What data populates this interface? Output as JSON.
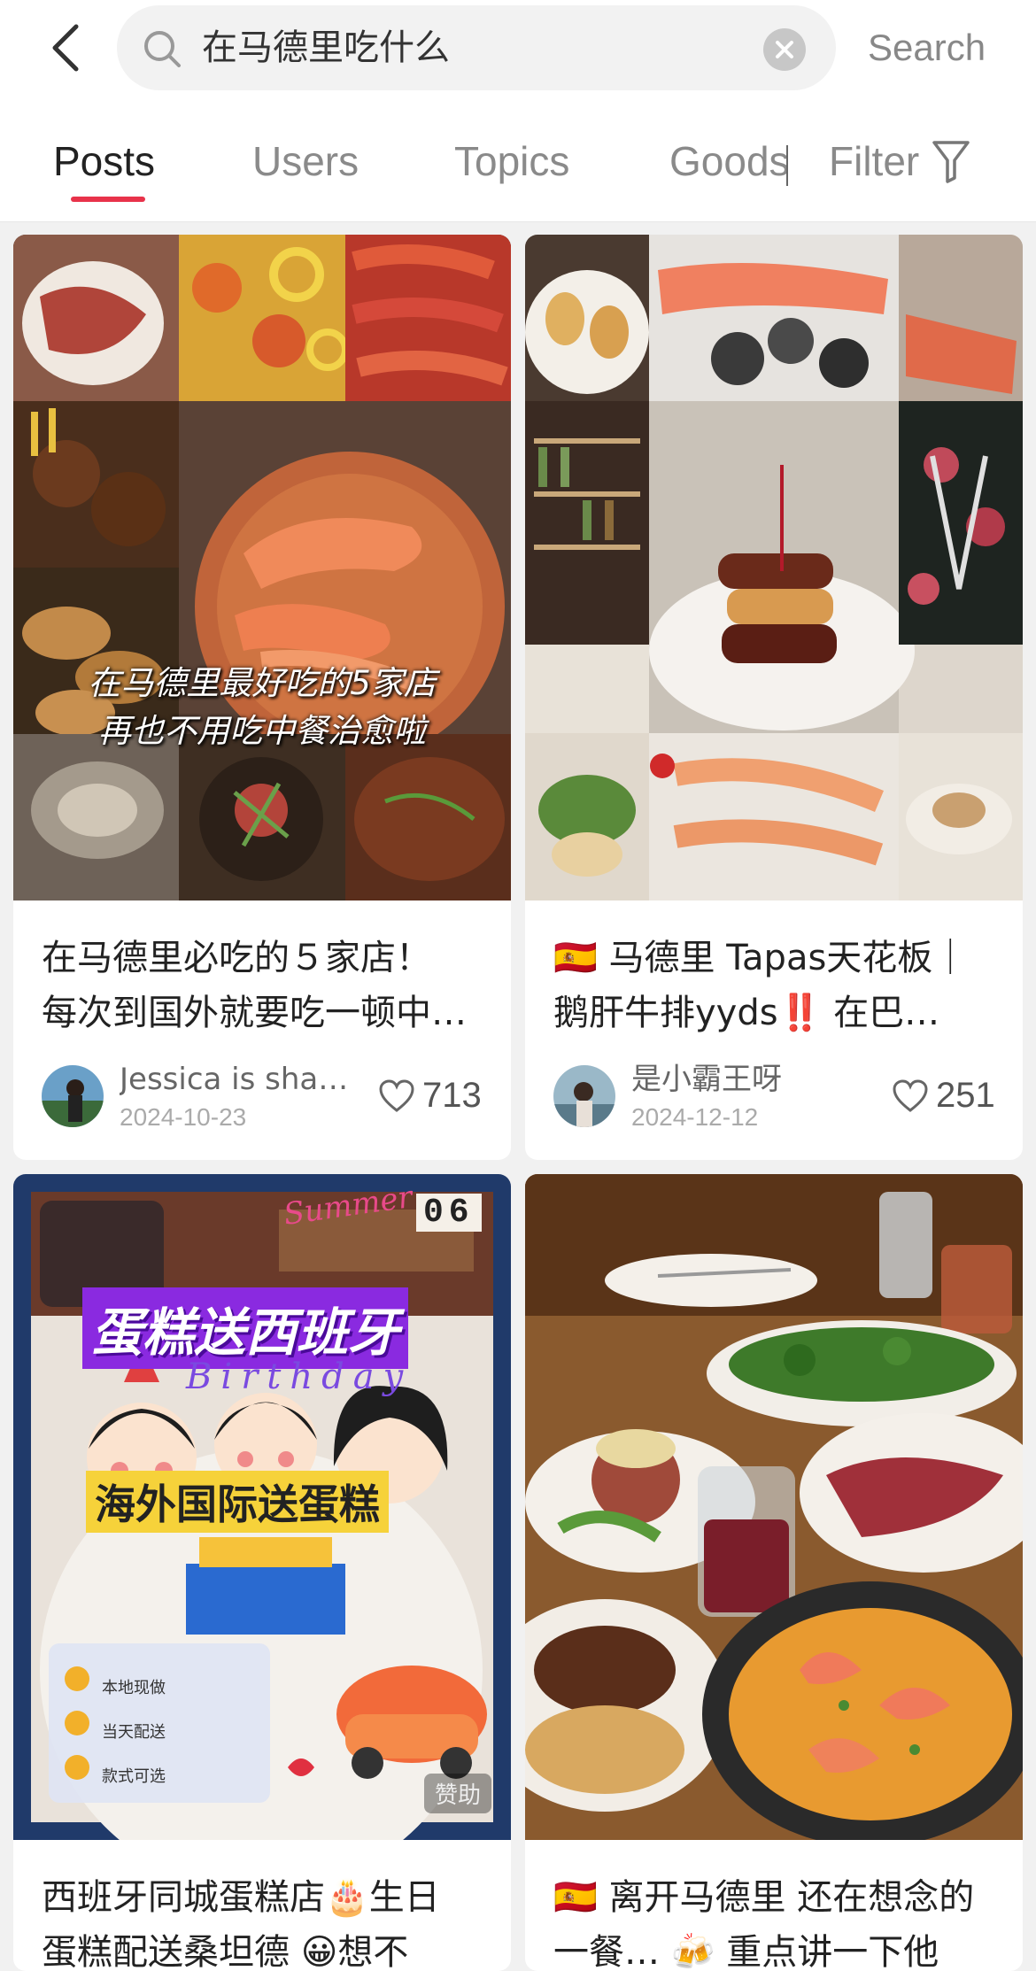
{
  "search": {
    "query": "在马德里吃什么",
    "action_label": "Search"
  },
  "tabs": [
    {
      "label": "Posts",
      "active": true
    },
    {
      "label": "Users",
      "active": false
    },
    {
      "label": "Topics",
      "active": false
    },
    {
      "label": "Goods",
      "active": false
    }
  ],
  "filter_label": "Filter",
  "accent_color": "#e8324a",
  "posts": [
    {
      "cover_caption_line1": "在马德里最好吃的5家店",
      "cover_caption_line2": "再也不用吃中餐治愈啦",
      "title_line1": "在马德里必吃的５家店！",
      "title_line2": "每次到国外就要吃一顿中…",
      "author": "Jessica is sha…",
      "date": "2024-10-23",
      "likes": "713"
    },
    {
      "title_line1": "🇪🇸 马德里 Tapas天花板｜",
      "title_line2": "鹅肝牛排yyds‼️ 在巴…",
      "author": "是小霸王呀",
      "date": "2024-12-12",
      "likes": "251"
    },
    {
      "cover_headline": "蛋糕送西班牙",
      "cover_script": "Birthday",
      "cover_corner": "Summer",
      "cover_number": "06",
      "cover_sub": "海外国际送蛋糕",
      "cover_list": [
        "本地现做",
        "当天配送",
        "款式可选"
      ],
      "sponsor": "赞助",
      "title_line1": "西班牙同城蛋糕店🎂生日",
      "title_line2": "蛋糕配送桑坦德 😀想不"
    },
    {
      "title_line1": "🇪🇸 离开马德里 还在想念的",
      "title_line2": "一餐… 🍻 重点讲一下他"
    }
  ]
}
